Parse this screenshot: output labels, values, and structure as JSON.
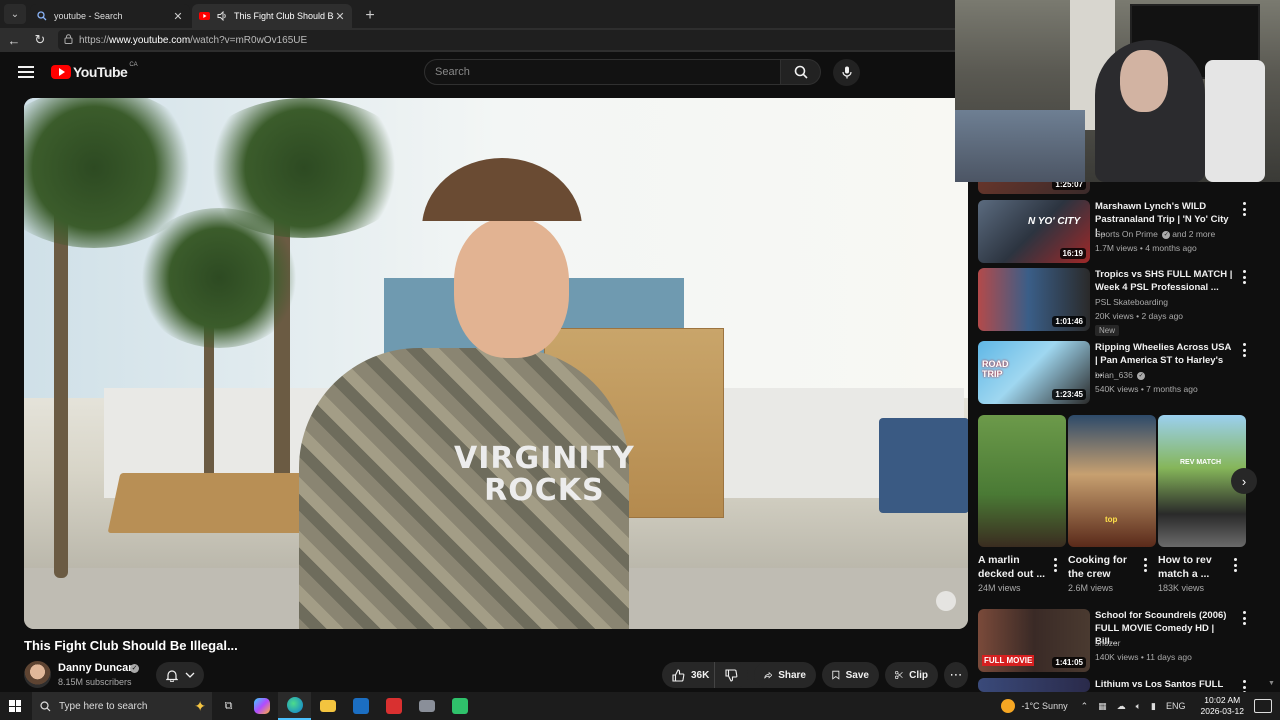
{
  "browser": {
    "tabs": [
      {
        "title": "youtube - Search",
        "active": false,
        "icon": "search-icon"
      },
      {
        "title": "This Fight Club Should Be Illegal",
        "active": true,
        "icon": "youtube-icon"
      }
    ],
    "url_prefix": "https://",
    "url_domain": "www.youtube.com",
    "url_path": "/watch?v=mR0wOv165UE"
  },
  "header": {
    "logo_text": "YouTube",
    "country": "CA",
    "search_placeholder": "Search"
  },
  "video": {
    "title": "This Fight Club Should Be Illegal...",
    "shirt_text_line1": "VIRGINITY",
    "shirt_text_line2": "ROCKS",
    "channel": "Danny Duncan",
    "subscribers": "8.15M subscribers",
    "likes": "36K",
    "share_label": "Share",
    "save_label": "Save",
    "clip_label": "Clip"
  },
  "sidebar": {
    "partial_duration": "1:25:07",
    "items": [
      {
        "title": "Marshawn Lynch's WILD Pastranaland Trip | 'N Yo' City |...",
        "channel": "Sports On Prime",
        "channel_extra": "and 2 more",
        "verified": true,
        "meta": "1.7M views • 4 months ago",
        "duration": "16:19",
        "thumb_text": "N YO' CITY",
        "badge": ""
      },
      {
        "title": "Tropics vs SHS  FULL MATCH | Week 4 PSL Professional ...",
        "channel": "PSL Skateboarding",
        "channel_extra": "",
        "verified": false,
        "meta": "20K views • 2 days ago",
        "duration": "1:01:46",
        "thumb_text": "",
        "badge": "New"
      },
      {
        "title": "Ripping Wheelies Across USA | Pan America ST to Harley's ...",
        "channel": "brian_636",
        "channel_extra": "",
        "verified": true,
        "meta": "540K views • 7 months ago",
        "duration": "1:23:45",
        "thumb_text": "ROAD TRIP",
        "badge": ""
      }
    ],
    "shorts": [
      {
        "title": "A marlin decked out ...",
        "views": "24M views",
        "thumb_text": ""
      },
      {
        "title": "Cooking for the crew",
        "views": "2.6M views",
        "thumb_text": "top"
      },
      {
        "title": "How to rev match a ...",
        "views": "183K views",
        "thumb_text": "REV MATCH"
      }
    ],
    "items2": [
      {
        "title": "School for Scoundrels (2006) FULL MOVIE Comedy HD | Bill...",
        "channel": "shozer",
        "meta": "140K views • 11 days ago",
        "duration": "1:41:05",
        "thumb_text": "FULL MOVIE"
      },
      {
        "title": "Lithium vs Los Santos  FULL",
        "channel": "",
        "meta": "",
        "duration": "",
        "thumb_text": ""
      }
    ]
  },
  "taskbar": {
    "search_placeholder": "Type here to search",
    "weather": "-1°C  Sunny",
    "language": "ENG",
    "time": "10:02 AM",
    "date": "2026-03-12"
  },
  "colors": {
    "yt_red": "#ff0000",
    "background": "#0f0f0f",
    "pill": "#272727",
    "taskbar_accent": "#4cc2ff"
  }
}
